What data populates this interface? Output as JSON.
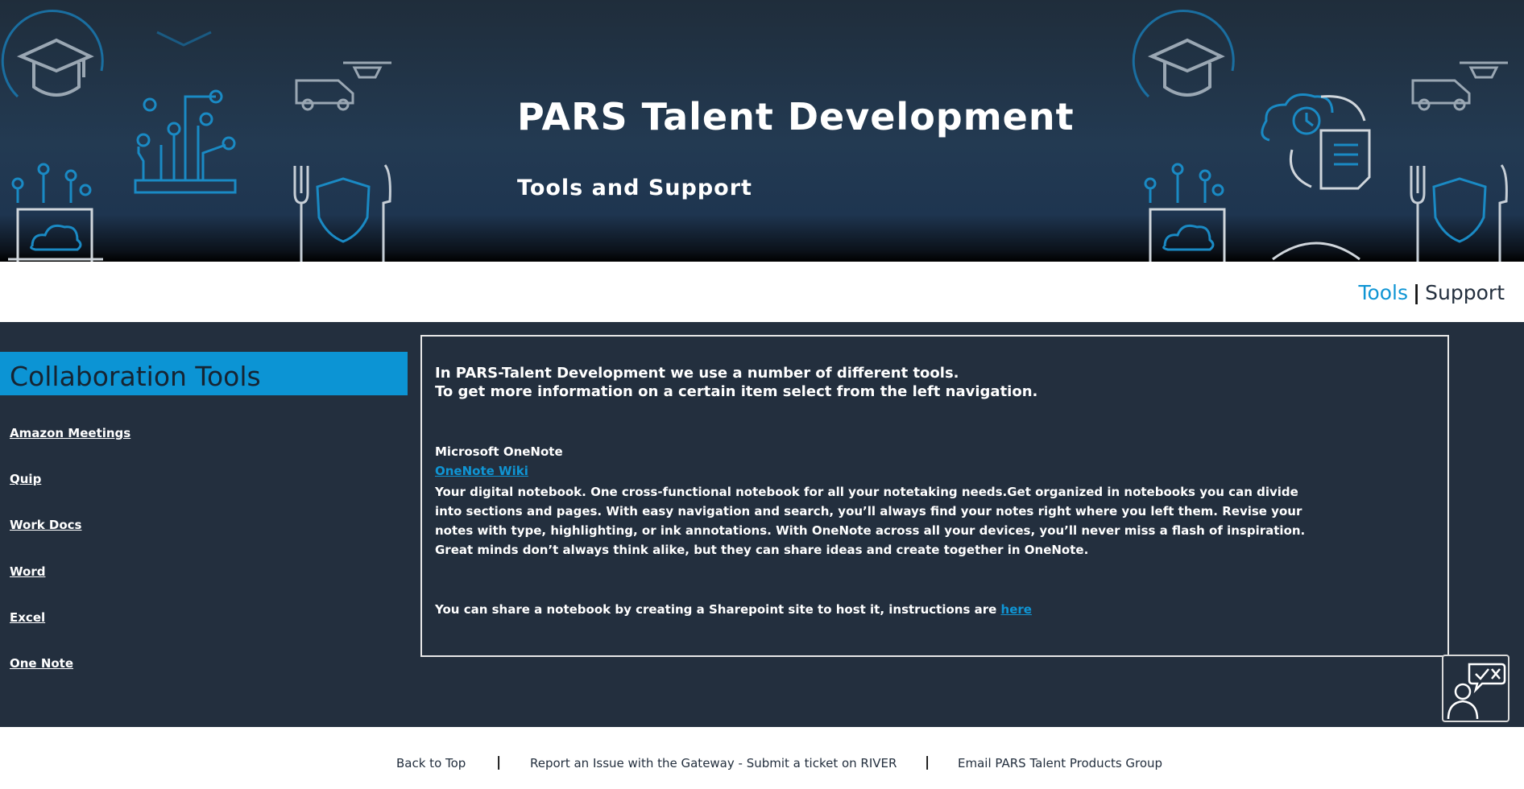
{
  "hero": {
    "title": "PARS Talent Development",
    "subtitle": "Tools and Support"
  },
  "topnav": {
    "tools_label": "Tools",
    "separator": "|",
    "support_label": "Support"
  },
  "sidebar": {
    "title": "Collaboration Tools",
    "items": [
      {
        "label": "Amazon Meetings"
      },
      {
        "label": "Quip"
      },
      {
        "label": "Work Docs"
      },
      {
        "label": "Word"
      },
      {
        "label": "Excel"
      },
      {
        "label": "One Note"
      }
    ]
  },
  "content": {
    "intro_line1": "In PARS-Talent Development we use a number of different tools.",
    "intro_line2": "To get more information on a certain item select from the left navigation.",
    "tool_name": "Microsoft OneNote",
    "wiki_link": "OneNote Wiki",
    "description": "Your digital notebook. One cross-functional notebook for all your notetaking needs.Get organized in notebooks you can divide into sections and pages. With easy navigation and search, you’ll always find your notes right where you left them. Revise your notes with type, highlighting, or ink annotations. With OneNote across all your devices, you’ll never miss a flash of inspiration. Great minds don’t always think alike, but they can share ideas and create together in OneNote.",
    "share_text": "You can share a notebook by creating a Sharepoint site to host it, instructions are ",
    "share_link": "here"
  },
  "footer": {
    "back_to_top": "Back to Top",
    "separator": "|",
    "report_issue": "Report an Issue with the Gateway - Submit a ticket on RIVER",
    "email_group": "Email PARS Talent Products Group"
  },
  "icons": {
    "feedback": "feedback-person-icon",
    "banner_decorations": [
      "graduation-cap-icon",
      "drone-icon",
      "van-icon",
      "circuit-icon",
      "laptop-cloud-icon",
      "fork-knife-shield-icon",
      "cloud-clock-document-icon"
    ]
  },
  "colors": {
    "banner_bg": "#1f2d3b",
    "main_bg": "#232f3e",
    "accent_blue": "#0f95d4",
    "sidebar_header_bg": "#0c94d4",
    "deco_blue": "#1a8ac4",
    "deco_gray": "#9aa7b3"
  }
}
